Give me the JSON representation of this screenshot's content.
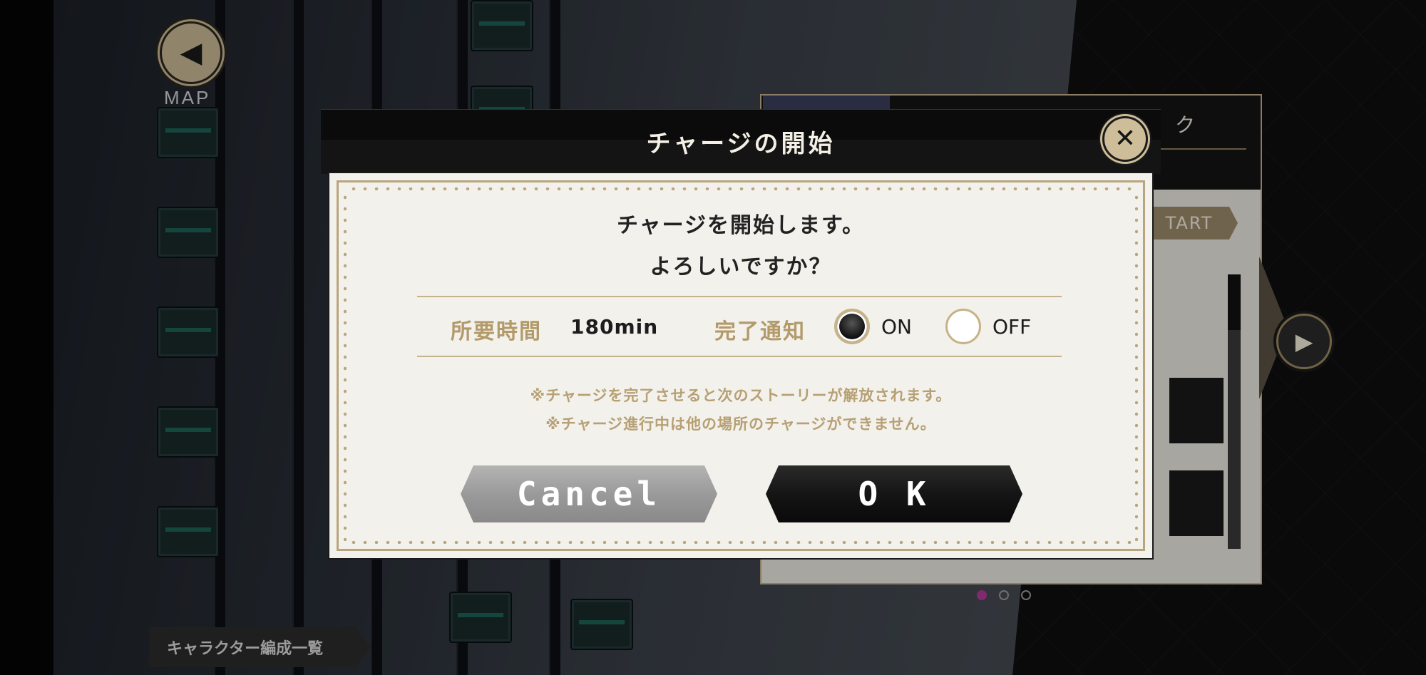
{
  "background": {
    "map_label": "MAP",
    "character_list_tab": "キャラクター編成一覧",
    "panel_title_fragment": "ク",
    "start_tab": "TART",
    "page_dots": {
      "count": 3,
      "active_index": 0,
      "active_color": "#b23a9a"
    }
  },
  "dialog": {
    "title": "チャージの開始",
    "message_line1": "チャージを開始します。",
    "message_line2": "よろしいですか？",
    "required_time_label": "所要時間",
    "required_time_value": "180min",
    "notification_label": "完了通知",
    "notification_on_label": "ON",
    "notification_off_label": "OFF",
    "notification_selected": "ON",
    "note1": "※チャージを完了させると次のストーリーが解放されます。",
    "note2": "※チャージ進行中は他の場所のチャージができません。",
    "cancel_label": "Cancel",
    "ok_label": "O K"
  },
  "colors": {
    "accent_gold": "#b29a6a",
    "dialog_bg": "#f3f1ec",
    "header_bg": "#0b0b0b"
  },
  "icons": {
    "back": "chevron-left-icon",
    "close": "close-icon",
    "next": "chevron-right-icon"
  }
}
